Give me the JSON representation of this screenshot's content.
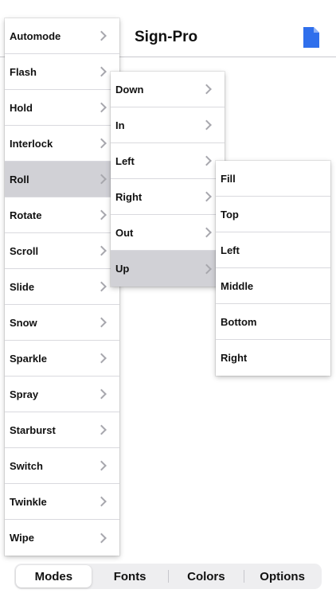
{
  "header": {
    "title": "Sign-Pro",
    "doc_icon": "document-icon",
    "doc_icon_color": "#2f6fec"
  },
  "menus": {
    "modes": {
      "selected": "Roll",
      "items": [
        "Automode",
        "Flash",
        "Hold",
        "Interlock",
        "Roll",
        "Rotate",
        "Scroll",
        "Slide",
        "Snow",
        "Sparkle",
        "Spray",
        "Starburst",
        "Switch",
        "Twinkle",
        "Wipe"
      ]
    },
    "roll": {
      "selected": "Up",
      "items": [
        "Down",
        "In",
        "Left",
        "Right",
        "Out",
        "Up"
      ]
    },
    "up": {
      "items": [
        "Fill",
        "Top",
        "Left",
        "Middle",
        "Bottom",
        "Right"
      ]
    }
  },
  "tabs": {
    "active": "Modes",
    "items": [
      "Modes",
      "Fonts",
      "Colors",
      "Options"
    ]
  },
  "colors": {
    "selected_row": "#d1d1d6",
    "chevron": "#a7a7ad",
    "accent": "#2f6fec"
  }
}
